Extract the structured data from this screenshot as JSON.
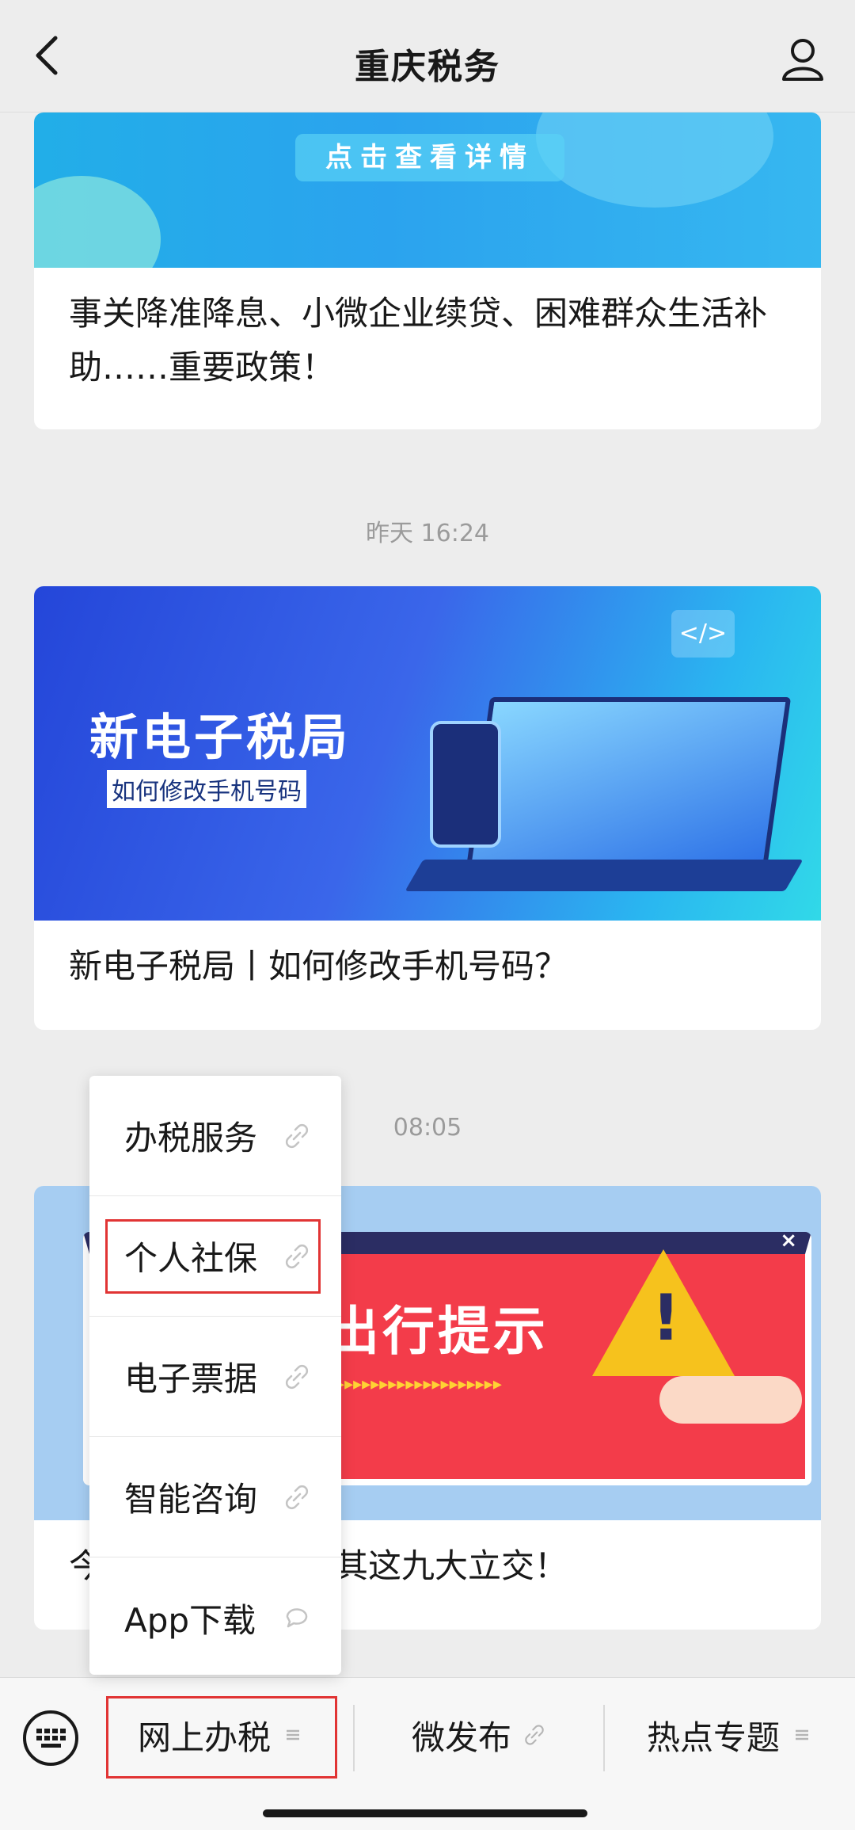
{
  "header": {
    "title": "重庆税务",
    "back_icon": "chevron-left-icon",
    "user_icon": "user-icon"
  },
  "feed": {
    "card1": {
      "banner_text": "点击查看详情",
      "caption": "事关降准降息、小微企业续贷、困难群众生活补助……重要政策！"
    },
    "time2": "昨天 16:24",
    "card2": {
      "banner_title": "新电子税局",
      "banner_subtitle": "如何修改手机号码",
      "banner_tag": "</>",
      "caption": "新电子税局丨如何修改手机号码？"
    },
    "time3": "08:05",
    "card3": {
      "banner_text": "出行提示",
      "banner_arrows": "▸▸▸▸▸▸▸▸▸▸▸▸▸▸▸▸▸▸▸▸",
      "close_label": "×",
      "caption": "今日出行高峰！尤其这九大立交！"
    }
  },
  "menu": {
    "items": [
      {
        "label": "办税服务",
        "icon": "link-icon"
      },
      {
        "label": "个人社保",
        "icon": "link-icon",
        "highlighted": true
      },
      {
        "label": "电子票据",
        "icon": "link-icon"
      },
      {
        "label": "智能咨询",
        "icon": "link-icon"
      },
      {
        "label": "App下载",
        "icon": "chat-bubble-icon"
      }
    ]
  },
  "bottom_bar": {
    "keyboard_icon": "keyboard-icon",
    "tabs": [
      {
        "label": "网上办税",
        "icon": "menu-lines-icon",
        "highlighted": true
      },
      {
        "label": "微发布",
        "icon": "link-icon"
      },
      {
        "label": "热点专题",
        "icon": "menu-lines-icon"
      }
    ]
  },
  "colors": {
    "background": "#ededed",
    "highlight_border": "#e13434",
    "text": "#191919",
    "timestamp": "#9b9b9b"
  }
}
